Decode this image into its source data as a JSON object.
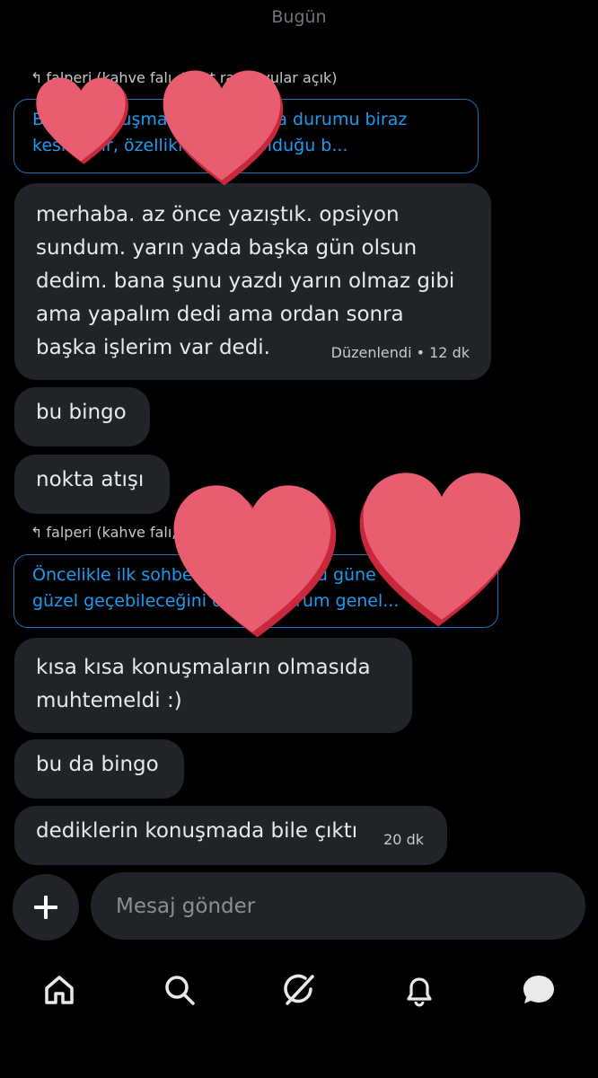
{
  "date_divider": "Bugün",
  "reply_context_1": {
    "header": "falperi (kahve falı, tarot randevular açık)",
    "quote_lines": [
      "Bazen konuşmalarınızın akma durumu biraz",
      "kesilebilir, özellikle yoğun olduğu b..."
    ]
  },
  "messages": [
    {
      "text": "merhaba. az önce yazıştık. opsiyon\nsundum. yarın yada başka gün olsun\ndedim. bana şunu yazdı yarın olmaz gibi\nama yapalım dedi ama ordan sonra\nbaşka işlerim var dedi.",
      "meta": "Düzenlendi • 12 dk"
    },
    {
      "text": "bu bingo"
    },
    {
      "text": "nokta atışı"
    }
  ],
  "reply_context_2": {
    "header": "falperi (kahve falı, tarot randevular açık)",
    "quote_lines": [
      "Öncelikle ilk sohbetiniz oldukça bu güne",
      "güzel geçebileceğini düşünüyorum genel..."
    ]
  },
  "messages_2": [
    {
      "text": "kısa kısa konuşmaların olmasıda\nmuhtemeldi :)"
    },
    {
      "text": "bu da bingo"
    },
    {
      "text": "dediklerin konuşmada bile çıktı",
      "meta": "20 dk"
    }
  ],
  "composer": {
    "placeholder": "Mesaj gönder",
    "add_icon": "plus-icon"
  },
  "nav": {
    "items": [
      "home-icon",
      "search-icon",
      "grok-icon",
      "notifications-icon",
      "messages-icon"
    ]
  },
  "colors": {
    "background": "#000000",
    "bubble": "#202327",
    "link_blue": "#1d9bf0",
    "heart_sticker": "#e85d70"
  }
}
